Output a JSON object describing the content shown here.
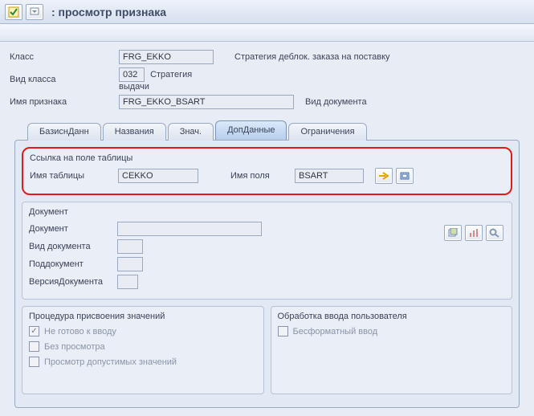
{
  "title": ": просмотр признака",
  "form": {
    "class_label": "Класс",
    "class_value": "FRG_EKKO",
    "class_desc": "Стратегия деблок. заказа на поставку",
    "kind_label": "Вид класса",
    "kind_value": "032",
    "kind_desc": "Стратегия выдачи",
    "char_label": "Имя признака",
    "char_value": "FRG_EKKO_BSART",
    "char_desc": "Вид документа"
  },
  "tabs": {
    "basic": "БазиснДанн",
    "names": "Названия",
    "values": "Знач.",
    "addtl": "ДопДанные",
    "restr": "Ограничения"
  },
  "table_ref": {
    "group_title": "Ссылка на поле таблицы",
    "table_label": "Имя таблицы",
    "table_value": "CEKKO",
    "field_label": "Имя поля",
    "field_value": "BSART"
  },
  "document": {
    "group_title": "Документ",
    "doc_label": "Документ",
    "type_label": "Вид документа",
    "part_label": "Поддокумент",
    "ver_label": "ВерсияДокумента"
  },
  "proc": {
    "group_title": "Процедура присвоения значений",
    "not_ready": "Не готово к вводу",
    "no_display": "Без просмотра",
    "allowed": "Просмотр допустимых значений"
  },
  "user": {
    "group_title": "Обработка ввода пользователя",
    "freeform": "Бесформатный ввод"
  }
}
